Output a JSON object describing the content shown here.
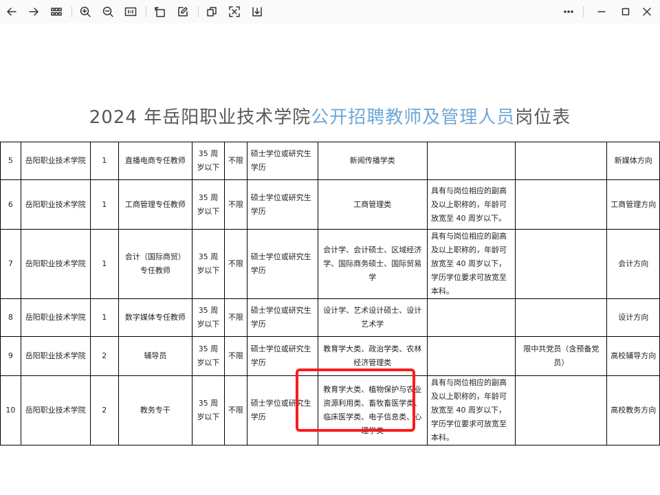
{
  "toolbar": {
    "buttons": [
      "back",
      "forward",
      "thumbnails",
      "zoom-in",
      "zoom-out",
      "actual-size",
      "rotate",
      "edit",
      "copy",
      "ocr-scan",
      "save",
      "more",
      "minimize",
      "maximize",
      "close"
    ]
  },
  "document": {
    "title_part1": "2024 年岳阳职业技术学院",
    "title_part2": "公开招聘教师及管理人员",
    "title_part3": "岗位表",
    "highlight_color": "#ff1a1a",
    "rows": [
      {
        "no": "5",
        "unit": "岳阳职业技术学院",
        "count": "1",
        "position": "直播电商专任教师",
        "age": "35 周岁以下",
        "gender": "不限",
        "education": "硕士学位或研究生学历",
        "major": "新闻传播学类",
        "other": "",
        "political": "",
        "direction": "新媒体方向"
      },
      {
        "no": "6",
        "unit": "岳阳职业技术学院",
        "count": "1",
        "position": "工商管理专任教师",
        "age": "35 周岁以下",
        "gender": "不限",
        "education": "硕士学位或研究生学历",
        "major": "工商管理类",
        "other": "具有与岗位相应的副高及以上职称的，年龄可放宽至 40 周岁以下。",
        "political": "",
        "direction": "工商管理方向"
      },
      {
        "no": "7",
        "unit": "岳阳职业技术学院",
        "count": "1",
        "position": "会计（国际商贸）专任教师",
        "age": "35 周岁以下",
        "gender": "不限",
        "education": "硕士学位或研究生学历",
        "major": "会计学、会计硕士、区域经济学、国际商务硕士、国际贸易学",
        "other": "具有与岗位相应的副高及以上职称的，年龄可放宽至 40 周岁以下，学历学位要求可放宽至本科。",
        "political": "",
        "direction": "会计方向"
      },
      {
        "no": "8",
        "unit": "岳阳职业技术学院",
        "count": "1",
        "position": "数字媒体专任教师",
        "age": "35 周岁以下",
        "gender": "不限",
        "education": "硕士学位或研究生学历",
        "major": "设计学、艺术设计硕士、设计艺术学",
        "other": "",
        "political": "",
        "direction": "设计方向"
      },
      {
        "no": "9",
        "unit": "岳阳职业技术学院",
        "count": "2",
        "position": "辅导员",
        "age": "35 周岁以下",
        "gender": "不限",
        "education": "硕士学位或研究生学历",
        "major": "教育学大类、政治学类、农林经济管理类",
        "other": "",
        "political": "限中共党员（含预备党员）",
        "direction": "高校辅导方向"
      },
      {
        "no": "10",
        "unit": "岳阳职业技术学院",
        "count": "2",
        "position": "教务专干",
        "age": "35 周岁以下",
        "gender": "不限",
        "education": "硕士学位或研究生学历",
        "major": "教育学大类、植物保护与农业资源利用类、畜牧畜医学类、临床医学类、电子信息类、心理学类",
        "other": "具有与岗位相应的副高及以上职称的，年龄可放宽至 40 周岁以下，学历学位要求可放宽至本科。",
        "political": "",
        "direction": "高校教务方向"
      }
    ]
  }
}
